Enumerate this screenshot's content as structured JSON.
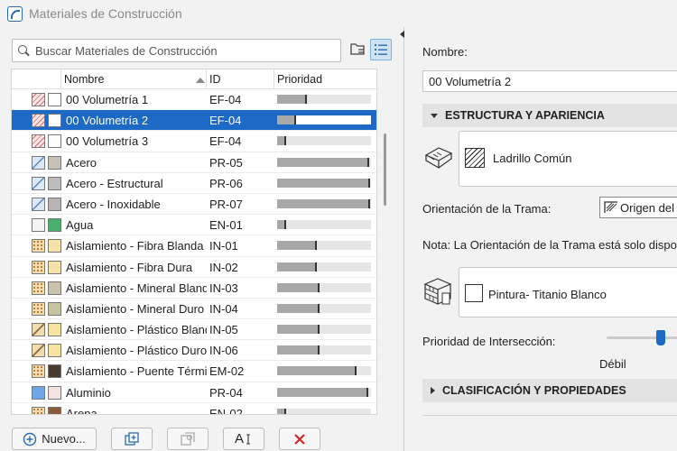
{
  "window": {
    "title": "Materiales de Construcción"
  },
  "search": {
    "placeholder": "Buscar Materiales de Construcción"
  },
  "columns": {
    "name": "Nombre",
    "id": "ID",
    "priority": "Prioridad"
  },
  "materials": [
    {
      "name": "00 Volumetría 1",
      "id": "EF-04",
      "priority": 0.32,
      "sw1": "#f7d9d9",
      "sw2": "#ffffff",
      "hatch1": "red",
      "selected": false
    },
    {
      "name": "00 Volumetría 2",
      "id": "EF-04",
      "priority": 0.2,
      "sw1": "#f7d9d9",
      "sw2": "#ffffff",
      "hatch1": "red",
      "selected": true
    },
    {
      "name": "00 Volumetría 3",
      "id": "EF-04",
      "priority": 0.1,
      "sw1": "#f7d9d9",
      "sw2": "#ffffff",
      "hatch1": "red",
      "selected": false
    },
    {
      "name": "Acero",
      "id": "PR-05",
      "priority": 0.98,
      "sw1": "#d8e6f7",
      "sw2": "#c7c2b8",
      "hatch1": "blue",
      "selected": false
    },
    {
      "name": "Acero - Estructural",
      "id": "PR-06",
      "priority": 0.99,
      "sw1": "#d8e6f7",
      "sw2": "#bcbcbc",
      "hatch1": "blue",
      "selected": false
    },
    {
      "name": "Acero - Inoxidable",
      "id": "PR-07",
      "priority": 0.99,
      "sw1": "#d8e6f7",
      "sw2": "#b5b3b3",
      "hatch1": "blue",
      "selected": false
    },
    {
      "name": "Agua",
      "id": "EN-01",
      "priority": 0.1,
      "sw1": "#f4f4f4",
      "sw2": "#4bae6e",
      "hatch1": "none",
      "selected": false
    },
    {
      "name": "Aislamiento - Fibra Blanda",
      "id": "IN-01",
      "priority": 0.42,
      "sw1": "#f2dcb0",
      "sw2": "#f4e2a8",
      "hatch1": "dots",
      "selected": false
    },
    {
      "name": "Aislamiento - Fibra Dura",
      "id": "IN-02",
      "priority": 0.42,
      "sw1": "#f2dcb0",
      "sw2": "#f4e2a8",
      "hatch1": "dots",
      "selected": false
    },
    {
      "name": "Aislamiento - Mineral Blando",
      "id": "IN-03",
      "priority": 0.45,
      "sw1": "#f2dcb0",
      "sw2": "#c9c2ad",
      "hatch1": "dots",
      "selected": false
    },
    {
      "name": "Aislamiento - Mineral Duro",
      "id": "IN-04",
      "priority": 0.45,
      "sw1": "#f2dcb0",
      "sw2": "#c5c3a0",
      "hatch1": "dots",
      "selected": false
    },
    {
      "name": "Aislamiento - Plástico Blando",
      "id": "IN-05",
      "priority": 0.45,
      "sw1": "#f2dcb0",
      "sw2": "#f7e4a0",
      "hatch1": "stripes",
      "selected": false
    },
    {
      "name": "Aislamiento - Plástico Duro",
      "id": "IN-06",
      "priority": 0.45,
      "sw1": "#f2dcb0",
      "sw2": "#f7e4a0",
      "hatch1": "stripes",
      "selected": false
    },
    {
      "name": "Aislamiento - Puente Térmi...",
      "id": "EM-02",
      "priority": 0.85,
      "sw1": "#f2dcb0",
      "sw2": "#4a3b30",
      "hatch1": "dots",
      "selected": false
    },
    {
      "name": "Aluminio",
      "id": "PR-04",
      "priority": 0.97,
      "sw1": "#6ea6e6",
      "sw2": "#f3e3e3",
      "hatch1": "none",
      "selected": false
    },
    {
      "name": "Arena",
      "id": "EN-02",
      "priority": 0.1,
      "sw1": "#f2dcb0",
      "sw2": "#8a5a3a",
      "hatch1": "dots",
      "selected": false
    }
  ],
  "buttons": {
    "new": "Nuevo...",
    "rename": "A"
  },
  "detail": {
    "name_label": "Nombre:",
    "name_value": "00 Volumetría 2",
    "section_structure": "ESTRUCTURA Y APARIENCIA",
    "cut_fill": "Ladrillo Común",
    "orientation_label": "Orientación de la Trama:",
    "orientation_value": "Origen del",
    "note": "Nota: La Orientación de la Trama está solo disponib",
    "surface": "Pintura- Titanio Blanco",
    "intersection_label": "Prioridad de Intersección:",
    "intersection_level": "Débil",
    "intersection_value": 0.75,
    "section_classification": "CLASIFICACIÓN Y PROPIEDADES"
  }
}
